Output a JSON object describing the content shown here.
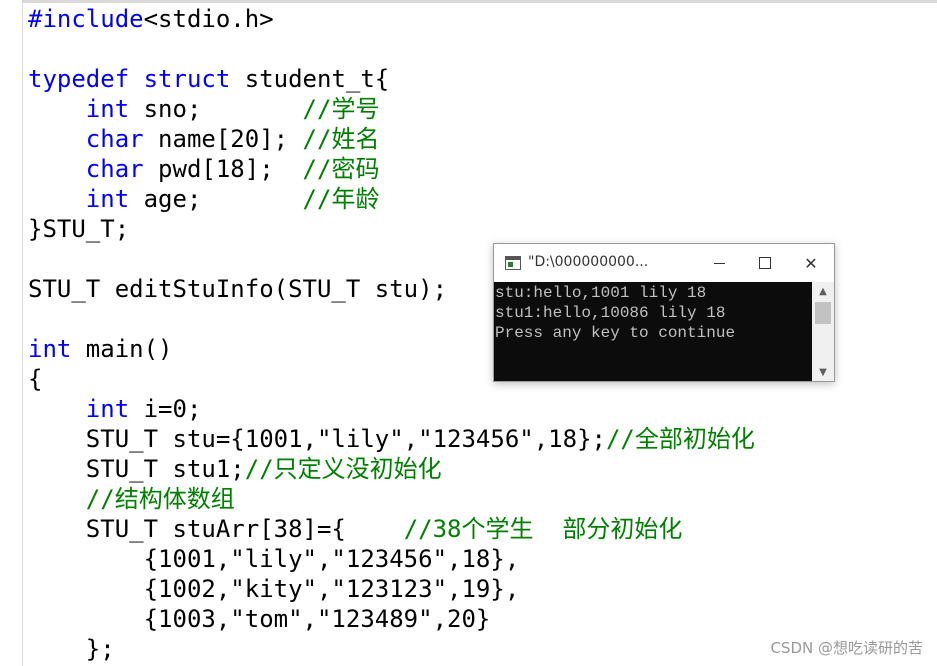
{
  "editor": {
    "lines": [
      [
        {
          "t": "#include",
          "c": "pp"
        },
        {
          "t": "<stdio.h>",
          "c": ""
        }
      ],
      [],
      [
        {
          "t": "typedef",
          "c": "kw"
        },
        {
          "t": " ",
          "c": ""
        },
        {
          "t": "struct",
          "c": "kw"
        },
        {
          "t": " student_t{",
          "c": ""
        }
      ],
      [
        {
          "t": "    ",
          "c": ""
        },
        {
          "t": "int",
          "c": "kw"
        },
        {
          "t": " sno;       ",
          "c": ""
        },
        {
          "t": "//学号",
          "c": "cm"
        }
      ],
      [
        {
          "t": "    ",
          "c": ""
        },
        {
          "t": "char",
          "c": "kw"
        },
        {
          "t": " name[20]; ",
          "c": ""
        },
        {
          "t": "//姓名",
          "c": "cm"
        }
      ],
      [
        {
          "t": "    ",
          "c": ""
        },
        {
          "t": "char",
          "c": "kw"
        },
        {
          "t": " pwd[18];  ",
          "c": ""
        },
        {
          "t": "//密码",
          "c": "cm"
        }
      ],
      [
        {
          "t": "    ",
          "c": ""
        },
        {
          "t": "int",
          "c": "kw"
        },
        {
          "t": " age;       ",
          "c": ""
        },
        {
          "t": "//年龄",
          "c": "cm"
        }
      ],
      [
        {
          "t": "}STU_T;",
          "c": ""
        }
      ],
      [],
      [
        {
          "t": "STU_T editStuInfo(STU_T stu);",
          "c": ""
        }
      ],
      [],
      [
        {
          "t": "int",
          "c": "kw"
        },
        {
          "t": " main()",
          "c": ""
        }
      ],
      [
        {
          "t": "{",
          "c": ""
        }
      ],
      [
        {
          "t": "    ",
          "c": ""
        },
        {
          "t": "int",
          "c": "kw"
        },
        {
          "t": " i=0;",
          "c": ""
        }
      ],
      [
        {
          "t": "    STU_T stu={1001,\"lily\",\"123456\",18};",
          "c": ""
        },
        {
          "t": "//全部初始化",
          "c": "cm"
        }
      ],
      [
        {
          "t": "    STU_T stu1;",
          "c": ""
        },
        {
          "t": "//只定义没初始化",
          "c": "cm"
        }
      ],
      [
        {
          "t": "    ",
          "c": ""
        },
        {
          "t": "//结构体数组",
          "c": "cm"
        }
      ],
      [
        {
          "t": "    STU_T stuArr[38]={    ",
          "c": ""
        },
        {
          "t": "//38个学生  部分初始化",
          "c": "cm"
        }
      ],
      [
        {
          "t": "        {1001,\"lily\",\"123456\",18},",
          "c": ""
        }
      ],
      [
        {
          "t": "        {1002,\"kity\",\"123123\",19},",
          "c": ""
        }
      ],
      [
        {
          "t": "        {1003,\"tom\",\"123489\",20}",
          "c": ""
        }
      ],
      [
        {
          "t": "    };",
          "c": ""
        }
      ]
    ]
  },
  "console": {
    "title": "\"D:\\000000000...",
    "lines": [
      "stu:hello,1001 lily 18",
      "stu1:hello,10086 lily 18",
      "Press any key to continue"
    ],
    "min_label": "",
    "max_label": "",
    "close_label": "✕"
  },
  "watermark": "CSDN @想吃读研的苦",
  "colors": {
    "keyword": "#0000ff",
    "comment": "#008000",
    "console_bg": "#0c0c0c",
    "console_fg": "#c0c0c0"
  },
  "icons": {
    "app": "console-app-icon",
    "minimize": "minimize-icon",
    "maximize": "maximize-icon",
    "close": "close-icon"
  }
}
